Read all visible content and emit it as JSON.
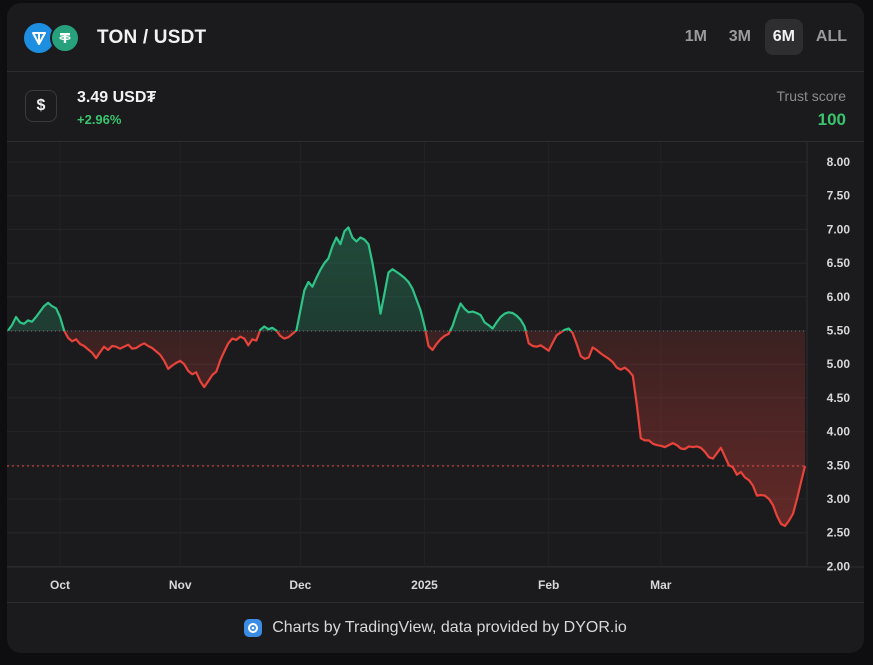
{
  "header": {
    "pair": "TON / USDT",
    "base_icon": "ton-icon",
    "quote_icon": "tether-icon",
    "ranges": [
      {
        "label": "1M",
        "active": false
      },
      {
        "label": "3M",
        "active": false
      },
      {
        "label": "6M",
        "active": true
      },
      {
        "label": "ALL",
        "active": false
      }
    ]
  },
  "price_info": {
    "icon": "dollar-icon",
    "price": "3.49 USD₮",
    "change": "+2.96%",
    "trust_label": "Trust score",
    "trust_value": "100"
  },
  "footer": {
    "icon": "tradingview-icon",
    "credit": "Charts by TradingView, data provided by DYOR.io"
  },
  "colors": {
    "up": "#2ec487",
    "down": "#e8433b",
    "background": "#1b1b1d",
    "trust": "#3ac46e"
  },
  "chart_data": {
    "type": "area",
    "baseline": 5.49,
    "last_price": 3.49,
    "x_range": [
      0,
      192
    ],
    "x_ticks": [
      {
        "x": 13,
        "label": "Oct"
      },
      {
        "x": 43,
        "label": "Nov"
      },
      {
        "x": 73,
        "label": "Dec"
      },
      {
        "x": 104,
        "label": "2025"
      },
      {
        "x": 135,
        "label": "Feb"
      },
      {
        "x": 163,
        "label": "Mar"
      }
    ],
    "y_ticks": [
      2.0,
      2.5,
      3.0,
      3.5,
      4.0,
      4.5,
      5.0,
      5.5,
      6.0,
      6.5,
      7.0,
      7.5,
      8.0
    ],
    "ylim": [
      2.0,
      8.0
    ],
    "grid": true,
    "points": [
      [
        0,
        5.5
      ],
      [
        1,
        5.58
      ],
      [
        2,
        5.7
      ],
      [
        3,
        5.62
      ],
      [
        4,
        5.6
      ],
      [
        5,
        5.65
      ],
      [
        6,
        5.63
      ],
      [
        7,
        5.7
      ],
      [
        8,
        5.78
      ],
      [
        9,
        5.86
      ],
      [
        10,
        5.91
      ],
      [
        11,
        5.86
      ],
      [
        12,
        5.83
      ],
      [
        13,
        5.7
      ],
      [
        14,
        5.5
      ],
      [
        15,
        5.39
      ],
      [
        16,
        5.34
      ],
      [
        17,
        5.37
      ],
      [
        18,
        5.3
      ],
      [
        19,
        5.27
      ],
      [
        20,
        5.22
      ],
      [
        21,
        5.17
      ],
      [
        22,
        5.09
      ],
      [
        23,
        5.18
      ],
      [
        24,
        5.26
      ],
      [
        25,
        5.21
      ],
      [
        26,
        5.27
      ],
      [
        27,
        5.26
      ],
      [
        28,
        5.23
      ],
      [
        29,
        5.26
      ],
      [
        30,
        5.29
      ],
      [
        31,
        5.23
      ],
      [
        32,
        5.24
      ],
      [
        33,
        5.28
      ],
      [
        34,
        5.31
      ],
      [
        35,
        5.27
      ],
      [
        36,
        5.24
      ],
      [
        37,
        5.19
      ],
      [
        38,
        5.14
      ],
      [
        39,
        5.05
      ],
      [
        40,
        4.93
      ],
      [
        41,
        4.98
      ],
      [
        42,
        5.02
      ],
      [
        43,
        5.05
      ],
      [
        44,
        5.0
      ],
      [
        45,
        4.9
      ],
      [
        46,
        4.85
      ],
      [
        47,
        4.88
      ],
      [
        48,
        4.75
      ],
      [
        49,
        4.66
      ],
      [
        50,
        4.75
      ],
      [
        51,
        4.84
      ],
      [
        52,
        4.89
      ],
      [
        53,
        5.06
      ],
      [
        54,
        5.19
      ],
      [
        55,
        5.31
      ],
      [
        56,
        5.38
      ],
      [
        57,
        5.36
      ],
      [
        58,
        5.41
      ],
      [
        59,
        5.38
      ],
      [
        60,
        5.28
      ],
      [
        61,
        5.37
      ],
      [
        62,
        5.35
      ],
      [
        63,
        5.51
      ],
      [
        64,
        5.56
      ],
      [
        65,
        5.52
      ],
      [
        66,
        5.54
      ],
      [
        67,
        5.5
      ],
      [
        68,
        5.42
      ],
      [
        69,
        5.38
      ],
      [
        70,
        5.4
      ],
      [
        71,
        5.45
      ],
      [
        72,
        5.5
      ],
      [
        73,
        5.8
      ],
      [
        74,
        6.1
      ],
      [
        75,
        6.22
      ],
      [
        76,
        6.15
      ],
      [
        77,
        6.28
      ],
      [
        78,
        6.4
      ],
      [
        79,
        6.5
      ],
      [
        80,
        6.57
      ],
      [
        81,
        6.75
      ],
      [
        82,
        6.88
      ],
      [
        83,
        6.78
      ],
      [
        84,
        6.97
      ],
      [
        85,
        7.03
      ],
      [
        86,
        6.88
      ],
      [
        87,
        6.82
      ],
      [
        88,
        6.88
      ],
      [
        89,
        6.85
      ],
      [
        90,
        6.78
      ],
      [
        91,
        6.5
      ],
      [
        92,
        6.15
      ],
      [
        93,
        5.75
      ],
      [
        94,
        6.05
      ],
      [
        95,
        6.36
      ],
      [
        96,
        6.41
      ],
      [
        97,
        6.37
      ],
      [
        98,
        6.33
      ],
      [
        99,
        6.28
      ],
      [
        100,
        6.22
      ],
      [
        101,
        6.12
      ],
      [
        102,
        5.96
      ],
      [
        103,
        5.8
      ],
      [
        104,
        5.57
      ],
      [
        105,
        5.27
      ],
      [
        106,
        5.21
      ],
      [
        107,
        5.3
      ],
      [
        108,
        5.37
      ],
      [
        109,
        5.42
      ],
      [
        110,
        5.45
      ],
      [
        111,
        5.57
      ],
      [
        112,
        5.75
      ],
      [
        113,
        5.9
      ],
      [
        114,
        5.82
      ],
      [
        115,
        5.77
      ],
      [
        116,
        5.78
      ],
      [
        117,
        5.76
      ],
      [
        118,
        5.73
      ],
      [
        119,
        5.62
      ],
      [
        120,
        5.58
      ],
      [
        121,
        5.53
      ],
      [
        122,
        5.62
      ],
      [
        123,
        5.7
      ],
      [
        124,
        5.75
      ],
      [
        125,
        5.77
      ],
      [
        126,
        5.76
      ],
      [
        127,
        5.72
      ],
      [
        128,
        5.66
      ],
      [
        129,
        5.56
      ],
      [
        130,
        5.31
      ],
      [
        131,
        5.27
      ],
      [
        132,
        5.26
      ],
      [
        133,
        5.28
      ],
      [
        134,
        5.24
      ],
      [
        135,
        5.2
      ],
      [
        136,
        5.32
      ],
      [
        137,
        5.43
      ],
      [
        138,
        5.47
      ],
      [
        139,
        5.51
      ],
      [
        140,
        5.53
      ],
      [
        141,
        5.46
      ],
      [
        142,
        5.3
      ],
      [
        143,
        5.12
      ],
      [
        144,
        5.08
      ],
      [
        145,
        5.1
      ],
      [
        146,
        5.25
      ],
      [
        147,
        5.21
      ],
      [
        148,
        5.16
      ],
      [
        149,
        5.12
      ],
      [
        150,
        5.08
      ],
      [
        151,
        5.03
      ],
      [
        152,
        4.95
      ],
      [
        153,
        4.92
      ],
      [
        154,
        4.95
      ],
      [
        155,
        4.9
      ],
      [
        156,
        4.83
      ],
      [
        157,
        4.4
      ],
      [
        158,
        3.9
      ],
      [
        159,
        3.87
      ],
      [
        160,
        3.87
      ],
      [
        161,
        3.82
      ],
      [
        162,
        3.8
      ],
      [
        163,
        3.79
      ],
      [
        164,
        3.77
      ],
      [
        165,
        3.8
      ],
      [
        166,
        3.83
      ],
      [
        167,
        3.8
      ],
      [
        168,
        3.75
      ],
      [
        169,
        3.74
      ],
      [
        170,
        3.78
      ],
      [
        171,
        3.77
      ],
      [
        172,
        3.78
      ],
      [
        173,
        3.76
      ],
      [
        174,
        3.7
      ],
      [
        175,
        3.62
      ],
      [
        176,
        3.6
      ],
      [
        177,
        3.68
      ],
      [
        178,
        3.76
      ],
      [
        179,
        3.63
      ],
      [
        180,
        3.5
      ],
      [
        181,
        3.47
      ],
      [
        182,
        3.36
      ],
      [
        183,
        3.4
      ],
      [
        184,
        3.32
      ],
      [
        185,
        3.28
      ],
      [
        186,
        3.2
      ],
      [
        187,
        3.05
      ],
      [
        188,
        3.06
      ],
      [
        189,
        3.05
      ],
      [
        190,
        3.0
      ],
      [
        191,
        2.91
      ],
      [
        192,
        2.75
      ]
    ],
    "tail_points": [
      [
        193,
        2.63
      ],
      [
        194,
        2.6
      ],
      [
        195,
        2.68
      ],
      [
        196,
        2.78
      ],
      [
        197,
        3.0
      ],
      [
        198,
        3.25
      ],
      [
        199,
        3.49
      ]
    ]
  }
}
